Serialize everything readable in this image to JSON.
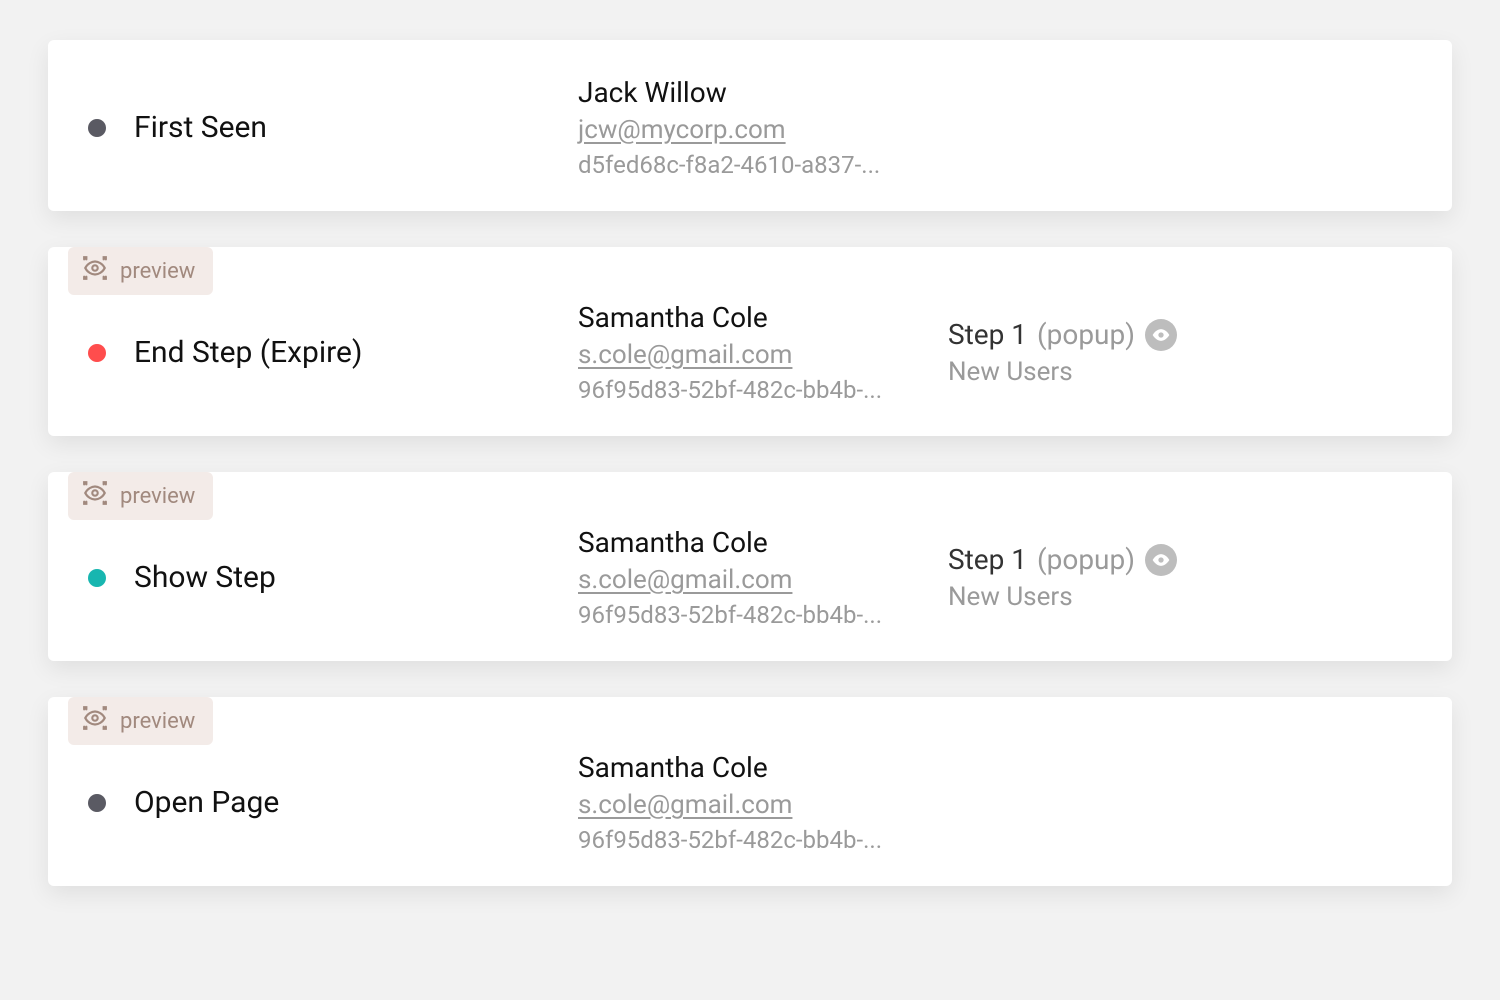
{
  "preview_label": "preview",
  "colors": {
    "dot_gray": "#5a5a63",
    "dot_red": "#ff4d4d",
    "dot_teal": "#18b6b0"
  },
  "events": [
    {
      "has_preview": false,
      "dot_color": "dot_gray",
      "event_label": "First Seen",
      "user_name": "Jack Willow",
      "user_email": "jcw@mycorp.com",
      "user_id": "d5fed68c-f8a2-4610-a837-...",
      "has_step": false
    },
    {
      "has_preview": true,
      "dot_color": "dot_red",
      "event_label": "End Step (Expire)",
      "user_name": "Samantha Cole",
      "user_email": "s.cole@gmail.com",
      "user_id": "96f95d83-52bf-482c-bb4b-...",
      "has_step": true,
      "step_label": "Step 1",
      "step_type": "(popup)",
      "step_sub": "New Users"
    },
    {
      "has_preview": true,
      "dot_color": "dot_teal",
      "event_label": "Show Step",
      "user_name": "Samantha Cole",
      "user_email": "s.cole@gmail.com",
      "user_id": "96f95d83-52bf-482c-bb4b-...",
      "has_step": true,
      "step_label": "Step 1",
      "step_type": "(popup)",
      "step_sub": "New Users"
    },
    {
      "has_preview": true,
      "dot_color": "dot_gray",
      "event_label": "Open Page",
      "user_name": "Samantha Cole",
      "user_email": "s.cole@gmail.com",
      "user_id": "96f95d83-52bf-482c-bb4b-...",
      "has_step": false
    }
  ]
}
